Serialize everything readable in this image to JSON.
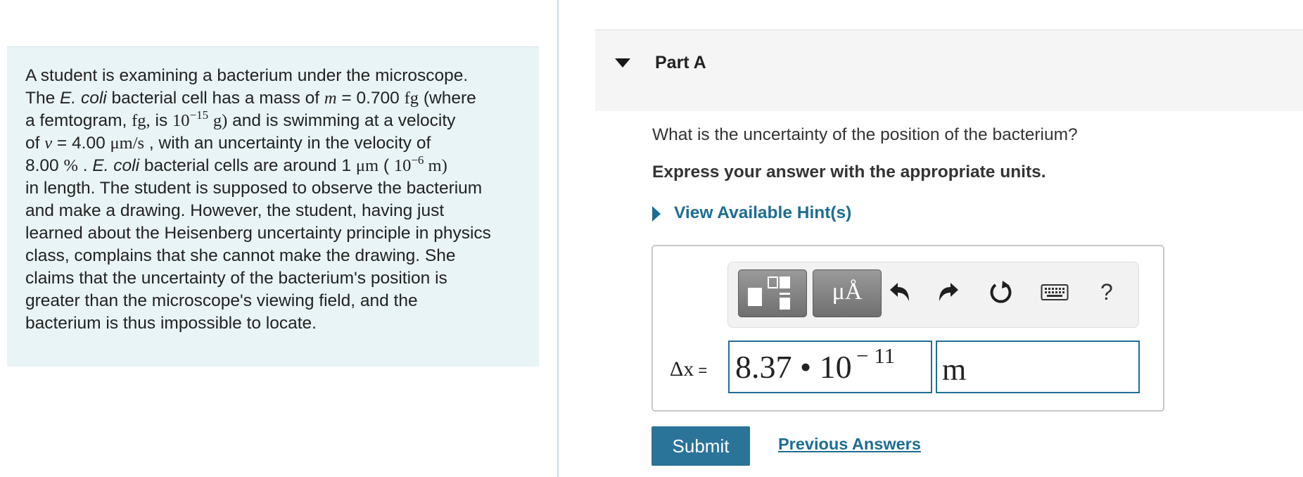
{
  "problem": {
    "lines": [
      [
        {
          "t": "A student is examining a bacterium under the microscope."
        }
      ],
      [
        {
          "t": "The "
        },
        {
          "t": "E. coli",
          "s": "i"
        },
        {
          "t": " bacterial cell has a mass of "
        },
        {
          "t": "m",
          "s": "math"
        },
        {
          "t": " = 0.700 "
        },
        {
          "t": "fg",
          "s": "serif"
        },
        {
          "t": " (where"
        }
      ],
      [
        {
          "t": "a femtogram, "
        },
        {
          "t": "fg,",
          "s": "serif"
        },
        {
          "t": "  is "
        },
        {
          "t": "10",
          "s": "serif"
        },
        {
          "t": "−15",
          "s": "sup"
        },
        {
          "t": " "
        },
        {
          "t": "g)",
          "s": "serif"
        },
        {
          "t": " and is swimming at a velocity"
        }
      ],
      [
        {
          "t": "of "
        },
        {
          "t": "v",
          "s": "math"
        },
        {
          "t": " = 4.00 "
        },
        {
          "t": "μm/s",
          "s": "serif"
        },
        {
          "t": " , with an uncertainty in the velocity of"
        }
      ],
      [
        {
          "t": "8.00 "
        },
        {
          "t": "%",
          "s": "serif"
        },
        {
          "t": " . "
        },
        {
          "t": "E. coli",
          "s": "i"
        },
        {
          "t": " bacterial cells are around 1 "
        },
        {
          "t": "μm",
          "s": "serif"
        },
        {
          "t": " ( "
        },
        {
          "t": "10",
          "s": "serif"
        },
        {
          "t": "−6",
          "s": "sup"
        },
        {
          "t": " m)",
          "s": "serif"
        }
      ],
      [
        {
          "t": "in length. The student is supposed to observe the bacterium"
        }
      ],
      [
        {
          "t": "and make a drawing. However, the student, having just"
        }
      ],
      [
        {
          "t": "learned about the Heisenberg uncertainty principle in physics"
        }
      ],
      [
        {
          "t": "class, complains that she cannot make the drawing. She"
        }
      ],
      [
        {
          "t": "claims that the uncertainty of the bacterium's position is"
        }
      ],
      [
        {
          "t": "greater than the microscope's viewing field, and the"
        }
      ],
      [
        {
          "t": "bacterium is thus impossible to locate."
        }
      ]
    ]
  },
  "part": {
    "title": "Part A",
    "toggle_icon": "triangle-down-icon"
  },
  "question": {
    "text": "What is the uncertainty of the position of the bacterium?",
    "instruction": "Express your answer with the appropriate units.",
    "hint_label": "View Available Hint(s)"
  },
  "toolbar": {
    "units_label": "μÅ",
    "help_label": "?",
    "icons": [
      "templates-icon",
      "units-icon",
      "undo-icon",
      "redo-icon",
      "reset-icon",
      "keyboard-icon",
      "help-icon"
    ]
  },
  "answer": {
    "label_symbol": "Δx",
    "label_eq": " =",
    "value_main": "8.37 • 10",
    "value_exponent": "− 11",
    "unit": "m"
  },
  "actions": {
    "submit_label": "Submit",
    "previous_answers_label": "Previous Answers"
  },
  "colors": {
    "problem_background": "#e9f4f6",
    "link": "#1d6d93",
    "submit_background": "#2a7399",
    "field_border": "#1f6e96"
  }
}
